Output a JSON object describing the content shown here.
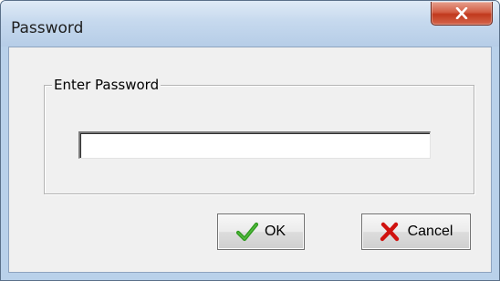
{
  "window": {
    "title": "Password",
    "close_icon": "close-x-icon"
  },
  "group": {
    "label": "Enter Password"
  },
  "password_field": {
    "value": "",
    "placeholder": ""
  },
  "buttons": {
    "ok": {
      "label": "OK",
      "icon": "checkmark-icon",
      "icon_color": "#2f9a1e"
    },
    "cancel": {
      "label": "Cancel",
      "icon": "red-x-icon",
      "icon_color": "#d0120f"
    }
  },
  "colors": {
    "titlebar": "#c6d9ee",
    "close_button": "#c1391d",
    "dialog_background": "#f0f0f0"
  }
}
